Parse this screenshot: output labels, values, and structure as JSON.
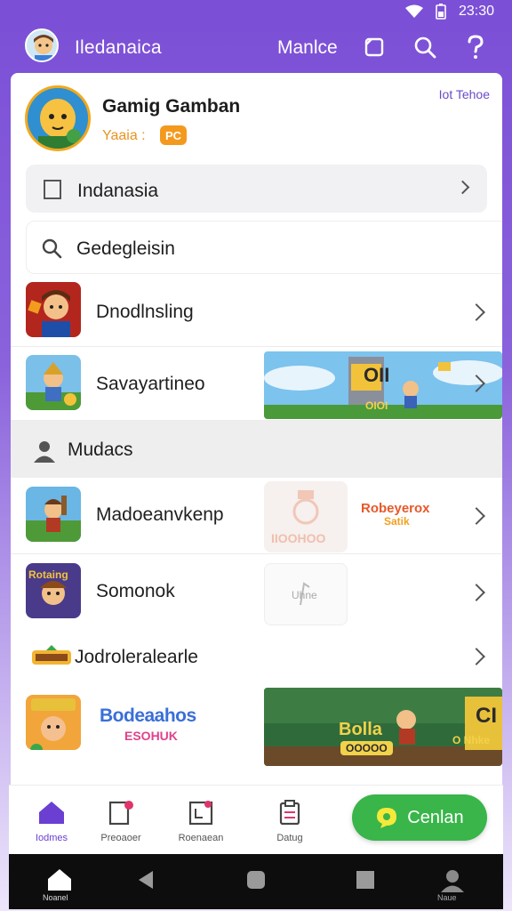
{
  "status_bar": {
    "time": "23:30"
  },
  "app_bar": {
    "title": "Iledanaica",
    "action_label": "Manlce"
  },
  "profile": {
    "name": "Gamig Gamban",
    "subtitle": "Yaaia :",
    "badge": "PC",
    "link": "Iot Tehoe"
  },
  "selector": {
    "label": "Indanasia"
  },
  "search": {
    "text": "Gedegleisin"
  },
  "rows_top": [
    {
      "label": "Dnodlnsling"
    },
    {
      "label": "Savayartineo"
    }
  ],
  "banner_top": {
    "title": "OII",
    "caption": "OIOI"
  },
  "section": {
    "title": "Mudacs"
  },
  "rows_bottom": [
    {
      "label": "Madoeanvkenp"
    },
    {
      "label": "Somonok"
    },
    {
      "label": "Jodroleralearle"
    }
  ],
  "promo": {
    "logo_text": "Robeyerox",
    "logo_sub": "Satik",
    "ghost_caption": "IIOOHOO",
    "ghost2_caption": "Uhne",
    "small_logo": "Rotaing",
    "big_logo": "Bodeaahos",
    "big_logo_sub": "ESOHUK",
    "game_title": "Bolla",
    "game_btn": "OOOOO",
    "game_side": "CI",
    "game_side_sub": "O Nhke"
  },
  "bottom_nav": [
    {
      "label": "Iodmes"
    },
    {
      "label": "Preoaoer"
    },
    {
      "label": "Roenaean"
    },
    {
      "label": "Datug"
    }
  ],
  "fab": {
    "label": "Cenlan"
  },
  "system_nav": {
    "home_label": "Noanel",
    "profile_label": "Naue"
  },
  "colors": {
    "accent": "#7b4fd6",
    "fab": "#39b54a",
    "badge": "#f39a1e"
  }
}
